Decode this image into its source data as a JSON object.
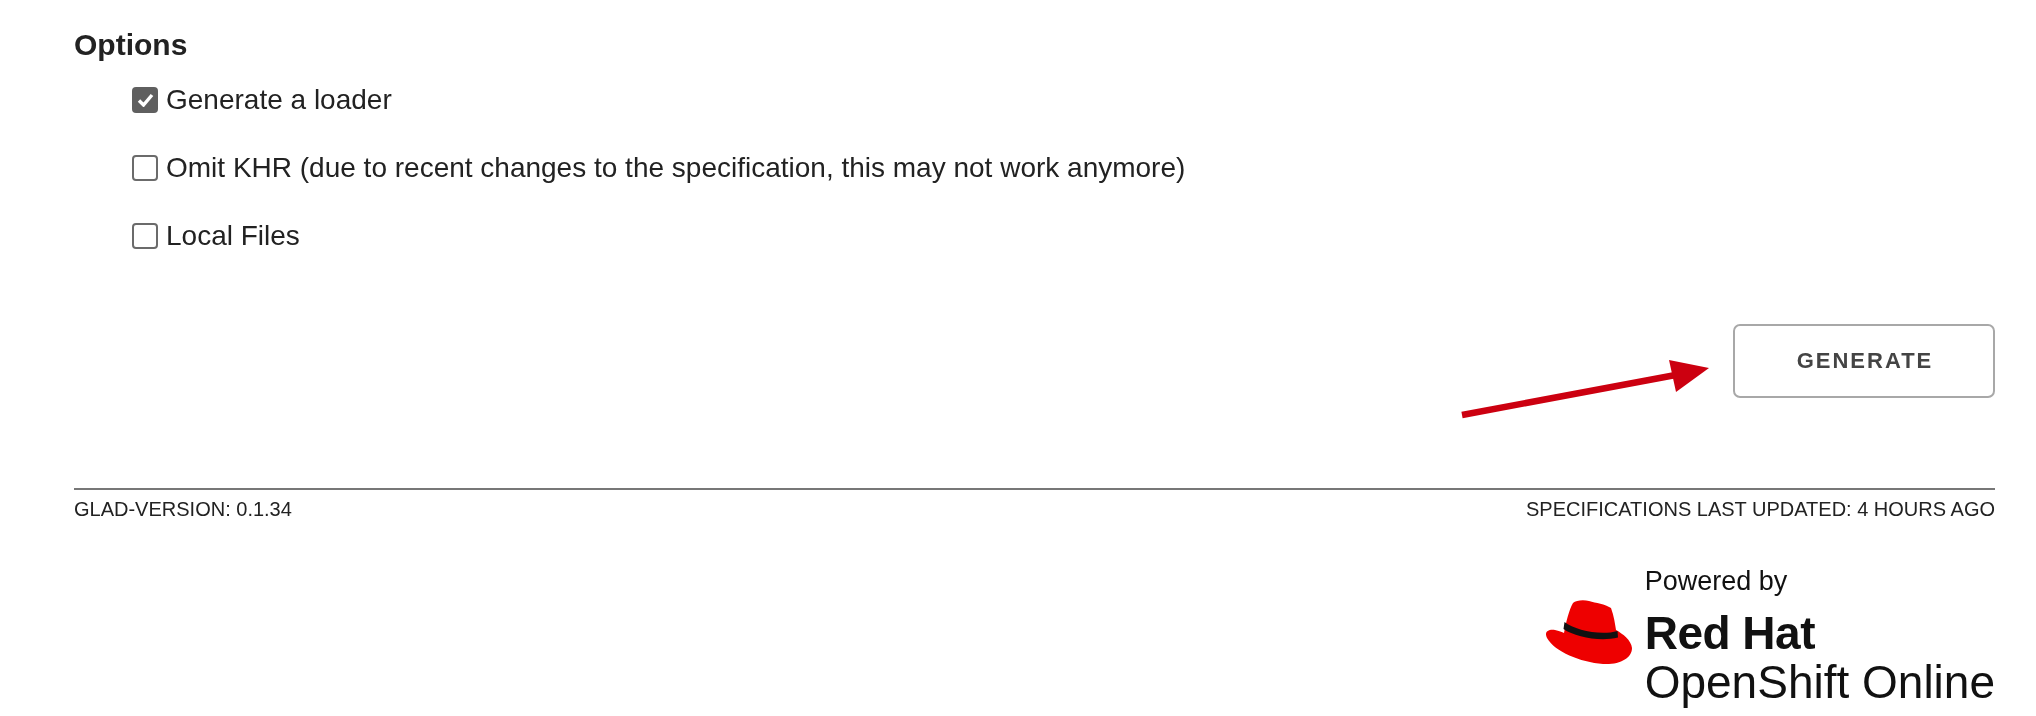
{
  "options": {
    "title": "Options",
    "items": [
      {
        "label": "Generate a loader",
        "checked": true
      },
      {
        "label": "Omit KHR (due to recent changes to the specification, this may not work anymore)",
        "checked": false
      },
      {
        "label": "Local Files",
        "checked": false
      }
    ]
  },
  "generate_button": {
    "label": "GENERATE"
  },
  "footer": {
    "version": "GLAD-VERSION: 0.1.34",
    "specifications_updated": "SPECIFICATIONS LAST UPDATED: 4 HOURS AGO"
  },
  "powered_by": {
    "label": "Powered by",
    "brand": "Red Hat",
    "product": "OpenShift Online"
  }
}
